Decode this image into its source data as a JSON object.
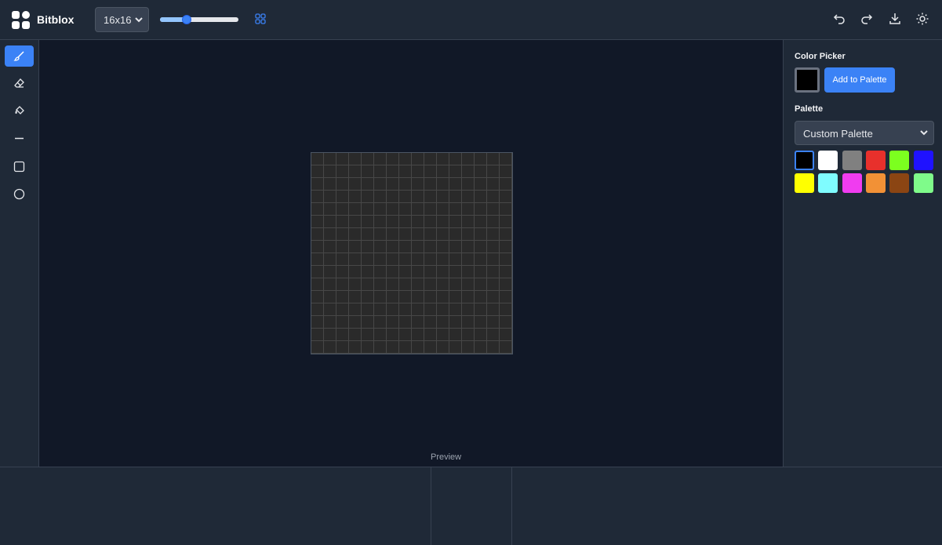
{
  "header": {
    "app_title": "Bitblox",
    "logo_icon": "four-squares-logo-icon",
    "grid_size": "16x16",
    "grid_size_options": [
      "16x16"
    ],
    "zoom_fraction": 0.34,
    "grid_toggle_icon": "grid-icon",
    "actions": [
      {
        "name": "undo-button",
        "icon": "undo-icon"
      },
      {
        "name": "redo-button",
        "icon": "redo-icon"
      },
      {
        "name": "download-button",
        "icon": "download-icon"
      },
      {
        "name": "theme-toggle-button",
        "icon": "sun-icon"
      }
    ]
  },
  "tools": [
    {
      "name": "brush-tool",
      "icon": "brush-icon",
      "active": true
    },
    {
      "name": "eraser-tool",
      "icon": "eraser-icon",
      "active": false
    },
    {
      "name": "fill-tool",
      "icon": "paint-bucket-icon",
      "active": false
    },
    {
      "name": "line-tool",
      "icon": "line-icon",
      "active": false
    },
    {
      "name": "rectangle-tool",
      "icon": "square-icon",
      "active": false
    },
    {
      "name": "circle-tool",
      "icon": "circle-icon",
      "active": false
    }
  ],
  "canvas": {
    "columns": 16,
    "rows": 16
  },
  "preview": {
    "label": "Preview"
  },
  "panel": {
    "color_picker_heading": "Color Picker",
    "current_color": "#000000",
    "add_button_label": "Add to Palette",
    "palette_heading": "Palette",
    "palette_selected": "Custom Palette",
    "swatches": [
      "#000000",
      "#ffffff",
      "#808080",
      "#e8302c",
      "#7cff1f",
      "#1f12ff",
      "#ffff00",
      "#7ffcff",
      "#f03cf0",
      "#f29136",
      "#8b4513",
      "#7ffb8a"
    ],
    "selected_swatch": 0
  },
  "colors": {
    "accent": "#3b82f6",
    "background": "#111827",
    "panel": "#1f2937"
  }
}
